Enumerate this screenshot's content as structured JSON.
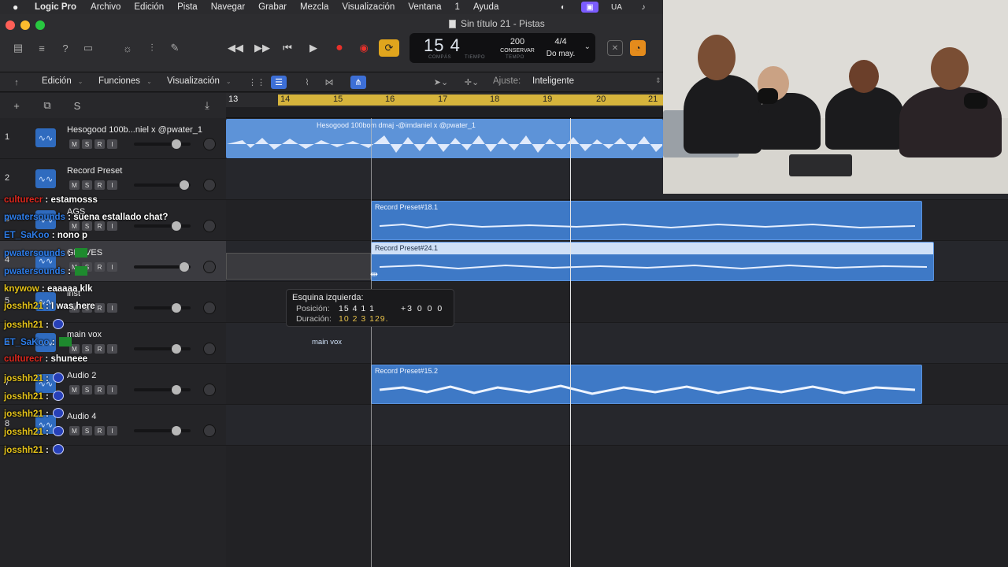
{
  "menubar": {
    "app_name": "Logic Pro",
    "items": [
      "Archivo",
      "Edición",
      "Pista",
      "Navegar",
      "Grabar",
      "Mezcla",
      "Visualización",
      "Ventana",
      "1",
      "Ayuda"
    ],
    "right": {
      "lang": "UA"
    }
  },
  "window": {
    "title": "Sin título 21 - Pistas"
  },
  "lcd": {
    "position": "15 4",
    "compas_label": "COMPÁS",
    "tiempo_label": "TIEMPO",
    "tempo": "200",
    "tempo_mode": "CONSERVAR",
    "tempo_label": "TEMPO",
    "signature": "4/4",
    "key": "Do may."
  },
  "subtoolbar": {
    "edit": "Edición",
    "functions": "Funciones",
    "view": "Visualización",
    "adjust_label": "Ajuste:",
    "adjust_value": "Inteligente"
  },
  "ruler": {
    "bars": [
      "13",
      "14",
      "15",
      "16",
      "17",
      "18",
      "19",
      "20",
      "21"
    ]
  },
  "tracks": [
    {
      "num": "1",
      "name": "Hesogood 100b...niel x @pwater_1"
    },
    {
      "num": "2",
      "name": "Record Preset"
    },
    {
      "num": "3",
      "name": "AGS"
    },
    {
      "num": "4",
      "name": "GRAVES"
    },
    {
      "num": "5",
      "name": "inst"
    },
    {
      "num": "6",
      "name": "main vox"
    },
    {
      "num": "7",
      "name": "Audio 2"
    },
    {
      "num": "8",
      "name": "Audio 4"
    }
  ],
  "regions": {
    "r1": "Hesogood 100bom dmaj -@imdaniel x @pwater_1",
    "r2": "Record Preset#18.1",
    "r3": "Record Preset#24.1",
    "r4": "main vox",
    "r5": "Record Preset#15.2"
  },
  "tooltip": {
    "title": "Esquina izquierda:",
    "pos_label": "Posición:",
    "pos_value": "15 4 1 1",
    "pos_delta": "+3 0 0 0",
    "dur_label": "Duración:",
    "dur_value": "10 2 3 129."
  },
  "chat": [
    {
      "user": "culturecr",
      "text": "estamosss",
      "color": "#e0281e"
    },
    {
      "user": "pwatersounds",
      "text": "suena estallado chat?",
      "color": "#2e7de9"
    },
    {
      "user": "ET_SaKoo",
      "text": "nono p",
      "color": "#2e7de9"
    },
    {
      "user": "pwatersounds",
      "text": "",
      "color": "#2e7de9"
    },
    {
      "user": "pwatersounds",
      "text": "",
      "color": "#2e7de9"
    },
    {
      "user": "knywow",
      "text": "eaaaaa klk",
      "color": "#e6c41a"
    },
    {
      "user": "josshh21",
      "text": "I was here",
      "color": "#e6c41a"
    },
    {
      "user": "josshh21",
      "text": "",
      "color": "#e6c41a"
    },
    {
      "user": "ET_SaKoo",
      "text": "",
      "color": "#2e7de9"
    },
    {
      "user": "culturecr",
      "text": "shuneee",
      "color": "#e0281e"
    },
    {
      "user": "josshh21",
      "text": "",
      "color": "#e6c41a"
    },
    {
      "user": "josshh21",
      "text": "",
      "color": "#e6c41a"
    },
    {
      "user": "josshh21",
      "text": "",
      "color": "#e6c41a"
    },
    {
      "user": "josshh21",
      "text": "",
      "color": "#e6c41a"
    },
    {
      "user": "josshh21",
      "text": "",
      "color": "#e6c41a"
    }
  ]
}
